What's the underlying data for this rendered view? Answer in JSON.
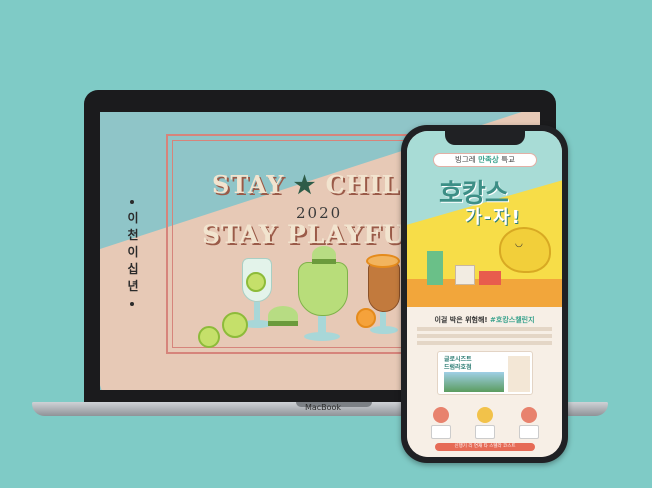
{
  "laptop": {
    "brand": "MacBook",
    "hero": {
      "title_line1_a": "STAY",
      "title_line1_b": "CHILL",
      "year": "2020",
      "title_line2": "STAY PLAYFU",
      "vertical_text": [
        "이",
        "천",
        "이",
        "십",
        "년"
      ]
    }
  },
  "phone": {
    "ribbon_prefix": "빙그레",
    "ribbon_highlight": "만족상",
    "ribbon_suffix": "특교",
    "headline1": "호캉스",
    "headline2": "가-자!",
    "body_head_prefix": "이걸 박은 위험해!",
    "body_head_highlight": "#호캉스챌린지",
    "card_title": "글로시즈트\n드럼라호점",
    "bottom_bar": "신행기 리 연재 타 스텔라 코스트"
  },
  "colors": {
    "background": "#7fcbc6",
    "accent_teal": "#3aa28d",
    "accent_yellow": "#f7dd48",
    "accent_red": "#e66b56"
  },
  "icons": [
    "star-icon",
    "lime-icon",
    "melon-icon",
    "orange-icon",
    "mango-character-icon"
  ]
}
